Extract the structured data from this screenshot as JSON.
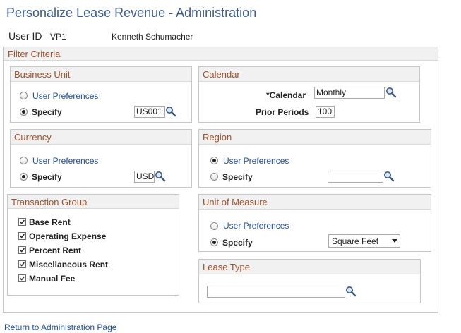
{
  "page": {
    "title": "Personalize Lease Revenue - Administration"
  },
  "user": {
    "label": "User ID",
    "id": "VP1",
    "name": "Kenneth Schumacher"
  },
  "filter": {
    "title": "Filter Criteria"
  },
  "business_unit": {
    "title": "Business Unit",
    "user_pref_label": "User Preferences",
    "specify_label": "Specify",
    "value": "US001",
    "selected": "specify"
  },
  "calendar": {
    "title": "Calendar",
    "calendar_label": "*Calendar",
    "calendar_value": "Monthly",
    "prior_periods_label": "Prior Periods",
    "prior_periods_value": "100"
  },
  "currency": {
    "title": "Currency",
    "user_pref_label": "User Preferences",
    "specify_label": "Specify",
    "value": "USD",
    "selected": "specify"
  },
  "region": {
    "title": "Region",
    "user_pref_label": "User Preferences",
    "specify_label": "Specify",
    "value": "",
    "selected": "user_preferences"
  },
  "transaction_group": {
    "title": "Transaction Group",
    "items": [
      {
        "label": "Base Rent",
        "checked": true
      },
      {
        "label": "Operating Expense",
        "checked": true
      },
      {
        "label": "Percent Rent",
        "checked": true
      },
      {
        "label": "Miscellaneous Rent",
        "checked": true
      },
      {
        "label": "Manual Fee",
        "checked": true
      }
    ]
  },
  "unit_of_measure": {
    "title": "Unit of Measure",
    "user_pref_label": "User Preferences",
    "specify_label": "Specify",
    "value": "Square Feet",
    "selected": "specify"
  },
  "lease_type": {
    "title": "Lease Type",
    "value": ""
  },
  "footer": {
    "return_link": "Return to Administration Page"
  },
  "icons": {
    "lookup": "magnifier-icon",
    "checkbox": "checkmark-icon",
    "dropdown": "chevron-down-icon"
  },
  "colors": {
    "title": "#3d5c8f",
    "section_heading": "#a0522d",
    "link": "#1f4e9e",
    "header_bg": "#f1f1f1",
    "border": "#c6c6c6"
  }
}
